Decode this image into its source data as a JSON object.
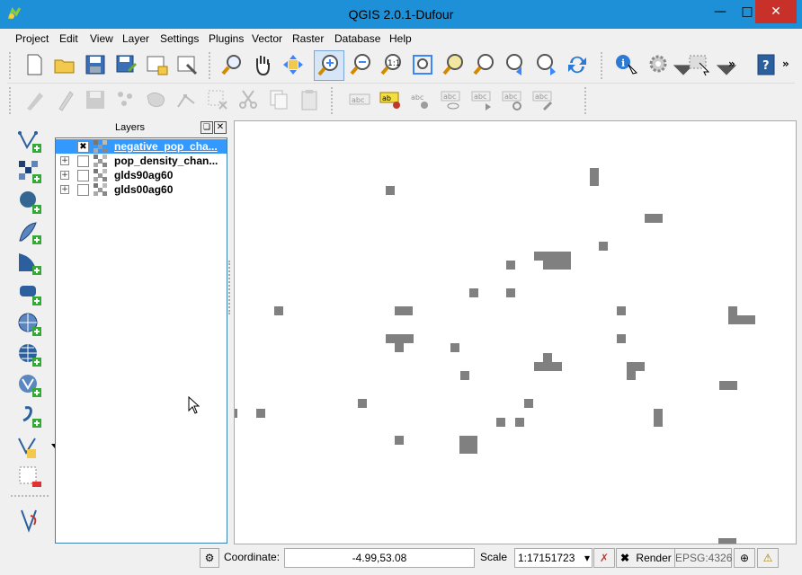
{
  "window": {
    "title": "QGIS 2.0.1-Dufour"
  },
  "menubar": [
    "Project",
    "Edit",
    "View",
    "Layer",
    "Settings",
    "Plugins",
    "Vector",
    "Raster",
    "Database",
    "Help"
  ],
  "layers_panel": {
    "title": "Layers",
    "layers": [
      {
        "name": "negative_pop_cha...",
        "checked": true,
        "selected": true
      },
      {
        "name": "pop_density_chan...",
        "checked": false,
        "selected": false
      },
      {
        "name": "glds90ag60",
        "checked": false,
        "selected": false
      },
      {
        "name": "glds00ag60",
        "checked": false,
        "selected": false
      }
    ]
  },
  "statusbar": {
    "coordinate_label": "Coordinate:",
    "coordinate_value": "-4.99,53.08",
    "scale_label": "Scale",
    "scale_value": "1:17151723",
    "render_label": "Render",
    "crs": "EPSG:4326"
  },
  "colors": {
    "titlebar": "#1e90d8",
    "selection": "#3399ff",
    "raster_cell": "#808080",
    "close": "#c7312a"
  }
}
